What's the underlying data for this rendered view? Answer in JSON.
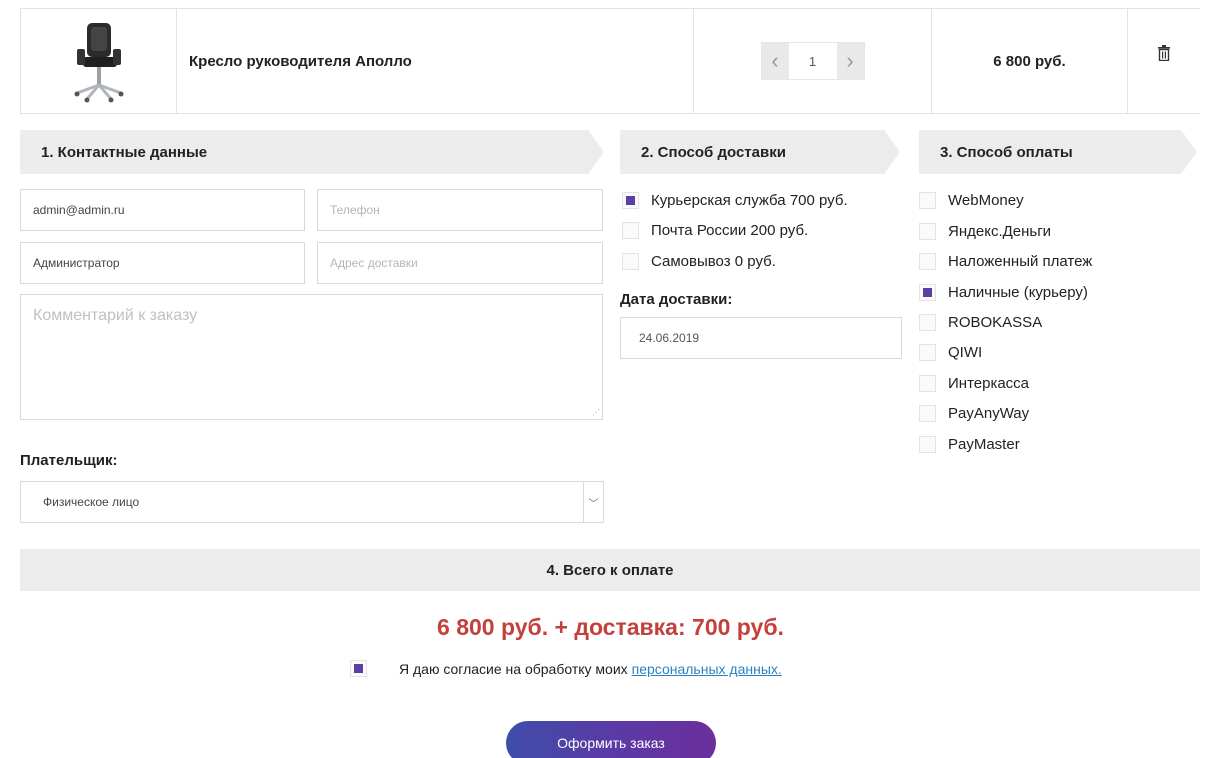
{
  "cart": {
    "product_name": "Кресло руководителя Аполло",
    "quantity": "1",
    "price": "6 800 руб.",
    "product_image_icon": "office-chair-icon",
    "delete_icon": "trash-icon"
  },
  "sections": {
    "contacts_title": "1. Контактные данные",
    "delivery_title": "2. Способ доставки",
    "payment_title": "3. Способ оплаты",
    "total_title": "4. Всего к оплате"
  },
  "contacts": {
    "email_value": "admin@admin.ru",
    "phone_placeholder": "Телефон",
    "name_value": "Администратор",
    "address_placeholder": "Адрес доставки",
    "comment_placeholder": "Комментарий к заказу",
    "payer_label": "Плательщик:",
    "payer_selected": "Физическое лицо"
  },
  "delivery": {
    "options": [
      {
        "label": "Курьерская служба 700 руб.",
        "checked": true
      },
      {
        "label": "Почта России 200 руб.",
        "checked": false
      },
      {
        "label": "Самовывоз 0 руб.",
        "checked": false
      }
    ],
    "date_label": "Дата доставки:",
    "date_value": "24.06.2019"
  },
  "payment": {
    "options": [
      {
        "label": "WebMoney",
        "checked": false
      },
      {
        "label": "Яндекс.Деньги",
        "checked": false
      },
      {
        "label": "Наложенный платеж",
        "checked": false
      },
      {
        "label": "Наличные (курьеру)",
        "checked": true
      },
      {
        "label": "ROBOKASSA",
        "checked": false
      },
      {
        "label": "QIWI",
        "checked": false
      },
      {
        "label": "Интеркасса",
        "checked": false
      },
      {
        "label": "PayAnyWay",
        "checked": false
      },
      {
        "label": "PayMaster",
        "checked": false
      }
    ]
  },
  "total": {
    "amount_text": "6 800 руб. + доставка: 700 руб.",
    "consent_text": "Я даю согласие на обработку моих",
    "consent_link": "персональных данных.",
    "consent_checked": true,
    "submit_label": "Оформить заказ"
  },
  "colors": {
    "accent": "#5b3fa4",
    "total_red": "#c4413b",
    "link": "#2a82c5"
  }
}
